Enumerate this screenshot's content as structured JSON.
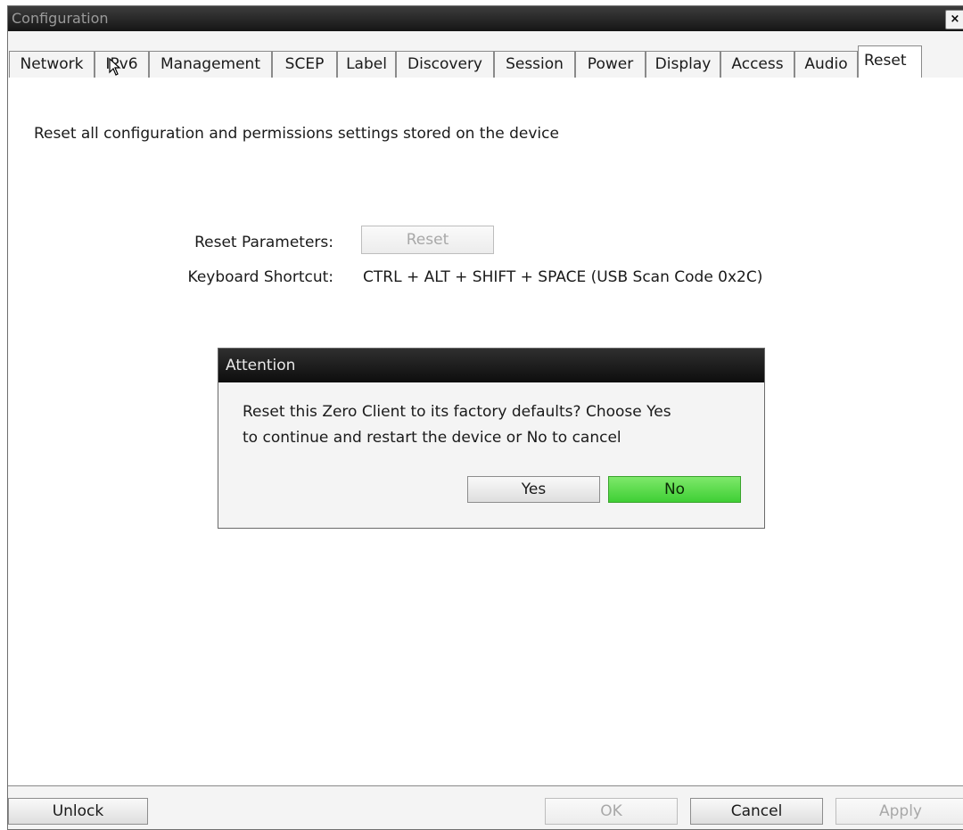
{
  "window": {
    "title": "Configuration",
    "close_label": "×"
  },
  "tabs": [
    {
      "label": "Network"
    },
    {
      "label": "IPv6"
    },
    {
      "label": "Management"
    },
    {
      "label": "SCEP"
    },
    {
      "label": "Label"
    },
    {
      "label": "Discovery"
    },
    {
      "label": "Session"
    },
    {
      "label": "Power"
    },
    {
      "label": "Display"
    },
    {
      "label": "Access"
    },
    {
      "label": "Audio"
    },
    {
      "label": "Reset",
      "active": true
    }
  ],
  "reset_page": {
    "description": "Reset all configuration and permissions settings stored on the device",
    "reset_parameters_label": "Reset Parameters:",
    "reset_button": "Reset",
    "keyboard_shortcut_label": "Keyboard Shortcut:",
    "keyboard_shortcut_value": "CTRL + ALT + SHIFT + SPACE (USB Scan Code 0x2C)"
  },
  "dialog": {
    "title": "Attention",
    "message_line1": "Reset this Zero Client to its factory defaults? Choose Yes",
    "message_line2": "to continue and restart the device or No to cancel",
    "yes_label": "Yes",
    "no_label": "No"
  },
  "footer": {
    "unlock_label": "Unlock",
    "ok_label": "OK",
    "cancel_label": "Cancel",
    "apply_label": "Apply"
  },
  "colors": {
    "no_button": "#4cd63f",
    "titlebar": "#222222"
  }
}
